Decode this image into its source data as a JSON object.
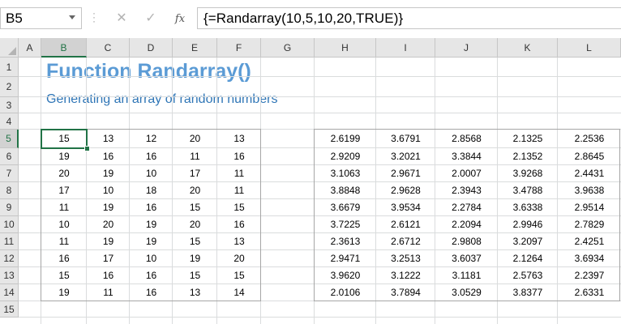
{
  "formula_bar": {
    "name_box": "B5",
    "cancel_icon": "✕",
    "enter_icon": "✓",
    "fx_label": "fx",
    "formula": "{=Randarray(10,5,10,20,TRUE)}"
  },
  "columns": [
    "A",
    "B",
    "C",
    "D",
    "E",
    "F",
    "G",
    "H",
    "I",
    "J",
    "K",
    "L"
  ],
  "rows": [
    "1",
    "2",
    "3",
    "4",
    "5",
    "6",
    "7",
    "8",
    "9",
    "10",
    "11",
    "12",
    "13",
    "14",
    "15"
  ],
  "sheet": {
    "title": "Function Randarray()",
    "subtitle": "Generating an array of random numbers"
  },
  "integer_array": [
    [
      "15",
      "13",
      "12",
      "20",
      "13"
    ],
    [
      "19",
      "16",
      "16",
      "11",
      "16"
    ],
    [
      "20",
      "19",
      "10",
      "17",
      "11"
    ],
    [
      "17",
      "10",
      "18",
      "20",
      "11"
    ],
    [
      "11",
      "19",
      "16",
      "15",
      "15"
    ],
    [
      "10",
      "20",
      "19",
      "20",
      "16"
    ],
    [
      "11",
      "19",
      "19",
      "15",
      "13"
    ],
    [
      "16",
      "17",
      "10",
      "19",
      "20"
    ],
    [
      "15",
      "16",
      "16",
      "15",
      "15"
    ],
    [
      "19",
      "11",
      "16",
      "13",
      "14"
    ]
  ],
  "decimal_array": [
    [
      "2.6199",
      "3.6791",
      "2.8568",
      "2.1325",
      "2.2536"
    ],
    [
      "2.9209",
      "3.2021",
      "3.3844",
      "2.1352",
      "2.8645"
    ],
    [
      "3.1063",
      "2.9671",
      "2.0007",
      "3.9268",
      "2.4431"
    ],
    [
      "3.8848",
      "2.9628",
      "2.3943",
      "3.4788",
      "3.9638"
    ],
    [
      "3.6679",
      "3.9534",
      "2.2784",
      "3.6338",
      "2.9514"
    ],
    [
      "3.7225",
      "2.6121",
      "2.2094",
      "2.9946",
      "2.7829"
    ],
    [
      "2.3613",
      "2.6712",
      "2.9808",
      "3.2097",
      "2.4251"
    ],
    [
      "2.9471",
      "3.2513",
      "3.6037",
      "2.1264",
      "3.6934"
    ],
    [
      "3.9620",
      "3.1222",
      "3.1181",
      "2.5763",
      "2.2397"
    ],
    [
      "2.0106",
      "3.7894",
      "3.0529",
      "3.8377",
      "2.6331"
    ]
  ]
}
